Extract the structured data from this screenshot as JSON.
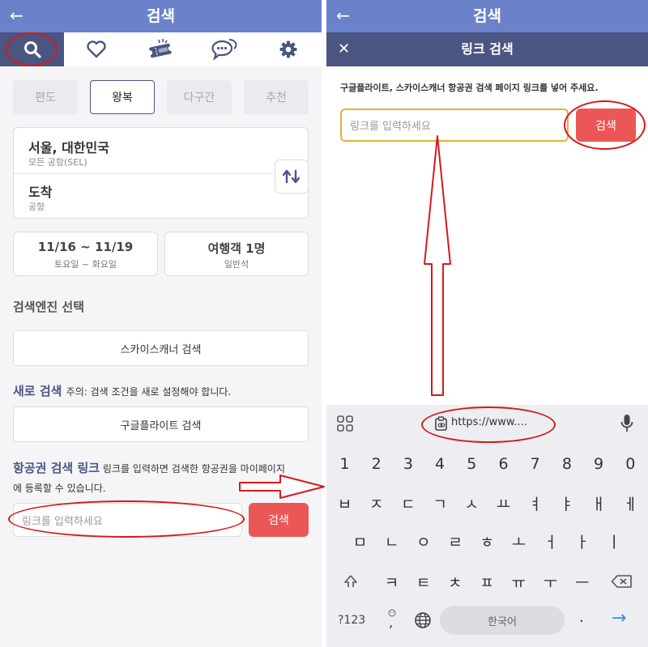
{
  "left": {
    "appbar": {
      "back_icon": "←",
      "title": "검색"
    },
    "tabs": [
      {
        "icon": "search-icon",
        "active": true
      },
      {
        "icon": "heart-icon",
        "active": false
      },
      {
        "icon": "ticket-icon",
        "active": false
      },
      {
        "icon": "chat-icon",
        "active": false
      },
      {
        "icon": "gear-icon",
        "active": false
      }
    ],
    "trip_types": [
      "편도",
      "왕복",
      "다구간",
      "추천"
    ],
    "departure": {
      "city": "서울, 대한민국",
      "airport": "모든 공항(SEL)"
    },
    "arrival": {
      "city": "도착",
      "airport": "공항"
    },
    "swap_icon": "swap-icon",
    "dates": {
      "range": "11/16 ~ 11/19",
      "days": "토요일 ~ 화요일"
    },
    "travelers": {
      "count": "여행객 1명",
      "cabin": "일반석"
    },
    "engine_section": "검색엔진 선택",
    "skyscanner_button": "스카이스캐너 검색",
    "new_search": {
      "title": "새로 검색",
      "note": "주의: 검색 조건을 새로 설정해야 합니다."
    },
    "google_button": "구글플라이트 검색",
    "link_section": {
      "title": "항공권 검색 링크",
      "note_line1": " 링크를 입력하면 검색한 항공권을 마이페이지",
      "note_line2": "에 등록할 수 있습니다."
    },
    "link_input_placeholder": "링크를 입력하세요",
    "link_search_button": "검색"
  },
  "right": {
    "appbar": {
      "back_icon": "←",
      "title": "검색"
    },
    "subbar": {
      "close_icon": "✕",
      "title": "링크 검색"
    },
    "instruction": "구글플라이트, 스카이스캐너 항공권 검색 페이지 링크를 넣어 주세요.",
    "link_input_placeholder": "링크를 입력하세요",
    "search_button": "검색",
    "keyboard": {
      "clipboard_suggestion": "https://www....",
      "numbers": [
        "1",
        "2",
        "3",
        "4",
        "5",
        "6",
        "7",
        "8",
        "9",
        "0"
      ],
      "row1": [
        "ㅂ",
        "ㅈ",
        "ㄷ",
        "ㄱ",
        "ㅅ",
        "ㅛ",
        "ㅕ",
        "ㅑ",
        "ㅐ",
        "ㅔ"
      ],
      "row2": [
        "ㅁ",
        "ㄴ",
        "ㅇ",
        "ㄹ",
        "ㅎ",
        "ㅗ",
        "ㅓ",
        "ㅏ",
        "ㅣ"
      ],
      "row3": [
        "ㅋ",
        "ㅌ",
        "ㅊ",
        "ㅍ",
        "ㅠ",
        "ㅜ",
        "ㅡ"
      ],
      "symbols_key": "?123",
      "comma_key": ",",
      "space_label": "한국어",
      "period_key": ".",
      "enter_icon": "→"
    }
  },
  "colors": {
    "header": "#6b82cb",
    "navy": "#4a5582",
    "accent_red": "#eb5757",
    "annotation_red": "#d51a1a",
    "input_border": "#e0b33a"
  }
}
